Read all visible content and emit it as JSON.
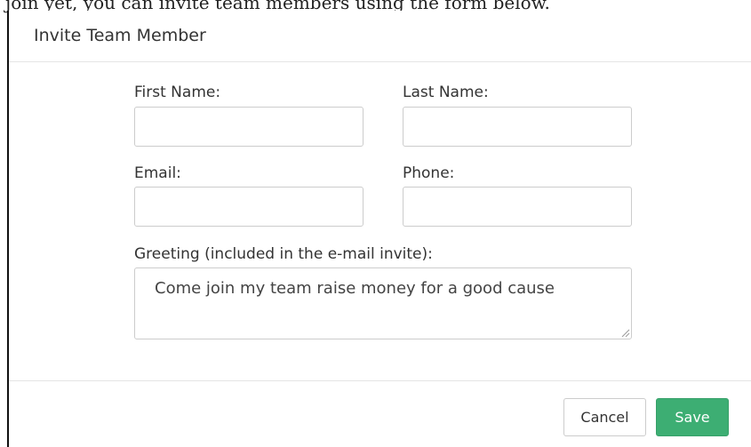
{
  "background": {
    "partial_text": "join yet, you can invite team members using the form below."
  },
  "modal": {
    "title": "Invite Team Member",
    "close_glyph": "×",
    "fields": {
      "first_name": {
        "label": "First Name:",
        "value": ""
      },
      "last_name": {
        "label": "Last Name:",
        "value": ""
      },
      "email": {
        "label": "Email:",
        "value": ""
      },
      "phone": {
        "label": "Phone:",
        "value": ""
      },
      "greeting": {
        "label": "Greeting (included in the e-mail invite):",
        "value": "Come join my team raise money for a good cause"
      }
    },
    "footer": {
      "cancel_label": "Cancel",
      "save_label": "Save"
    }
  },
  "colors": {
    "save_button": "#3dae73",
    "border": "#cccccc"
  },
  "icons": {
    "close": "close-icon",
    "resize": "resize-grip-icon"
  }
}
